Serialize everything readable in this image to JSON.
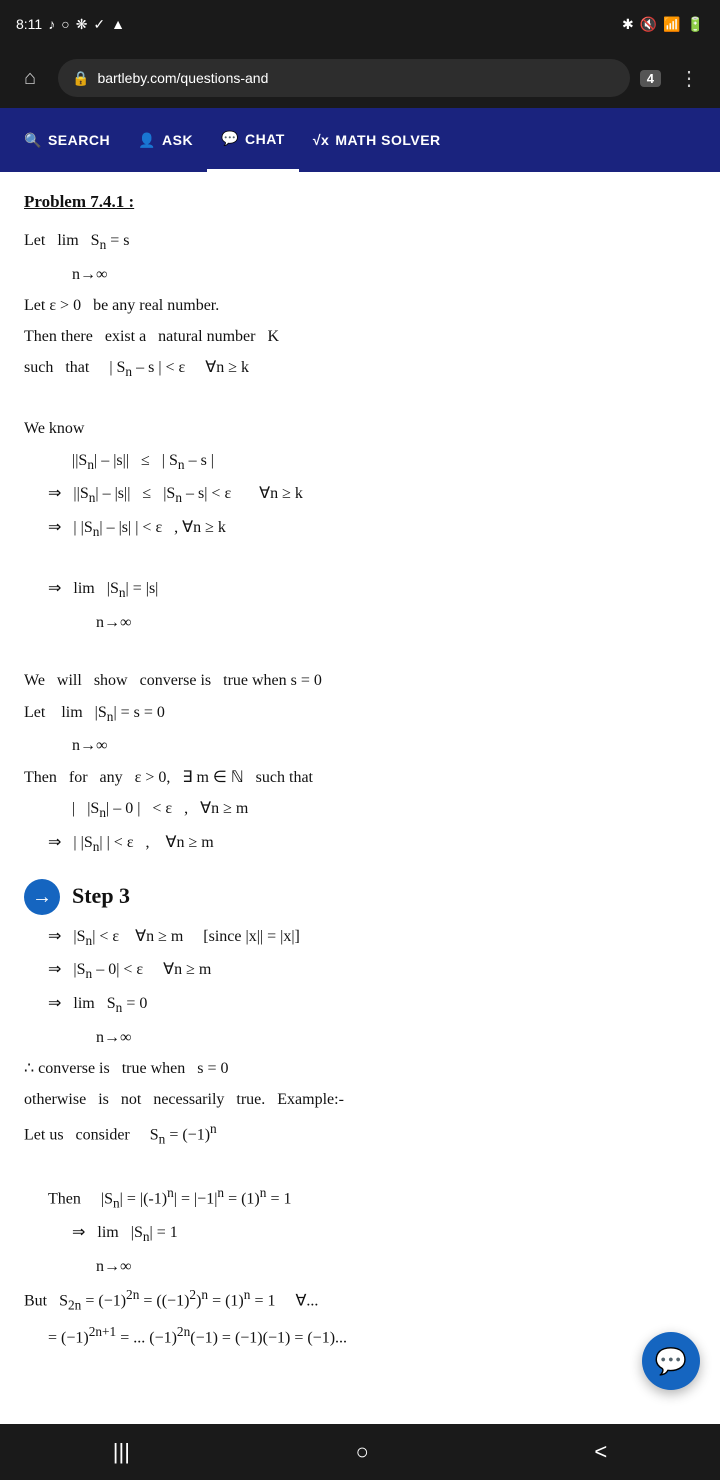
{
  "statusBar": {
    "time": "8:11",
    "icons_left": [
      "music-note",
      "circle-o",
      "settings-icon",
      "check-icon",
      "cloud-icon"
    ],
    "icons_right": [
      "bluetooth-icon",
      "mute-icon",
      "signal-icon",
      "battery-icon"
    ]
  },
  "browserBar": {
    "url": "bartleby.com/questions-and",
    "tabCount": "4",
    "homeIcon": "⌂",
    "menuIcon": "⋮"
  },
  "navBar": {
    "items": [
      {
        "id": "search",
        "label": "SEARCH",
        "icon": "🔍"
      },
      {
        "id": "ask",
        "label": "ASK",
        "icon": "👤"
      },
      {
        "id": "chat",
        "label": "CHAT",
        "icon": "💬"
      },
      {
        "id": "math",
        "label": "MATH SOLVER",
        "icon": "√x"
      }
    ],
    "activeItem": "chat"
  },
  "content": {
    "problemTitle": "Problem 7.4.1 :",
    "lines": [
      "Let  lim  Sₙ = s",
      "       n→∞",
      "Let ε > 0  be any real number.",
      "Then there  exist a  natural number  K",
      "such  that    | Sₙ – s | < ε    ∀n ≥ k",
      "",
      "We know",
      "    ||Sₙ| – |s||  ≤  | Sₙ – s |",
      "    ⇒  ||Sₙ| – |s||  ≤  |Sₙ – s| < ε      ∀n ≥ k",
      "    ⇒  | |Sₙ| – |s| | < ε  , ∀n ≥ k",
      "",
      "    ⇒  lim  |Sₙ| = |s|",
      "         n→∞",
      "",
      "We  will  show  converse is  true when s = 0",
      "Let   lim  |Sₙ| = s = 0",
      "        n→∞",
      "Then  for  any  ε > 0,  ∃ m ∈ ℕ  such that",
      "    |  |Sₙ| – 0 |  < ε  ,  ∀n ≥ m",
      "    ⇒  | |Sₙ| | < ε  ,   ∀n ≥ m"
    ],
    "step3": {
      "label": "Step 3",
      "lines": [
        "    ⇒  |Sₙ| < ε    ∀n ≥ m    [since |x|| = |x|]",
        "    ⇒  |Sₙ – 0| < ε    ∀n ≥ m",
        "    ⇒  lim  Sₙ = 0",
        "         n→∞",
        "∴ converse is  true when  s = 0",
        "otherwise  is  not  necessarily  true.  Example:-",
        "Let us  consider    Sₙ = (-1)ⁿ",
        "",
        "Then    |Sₙ| = |(-1)ⁿ| = |-1|ⁿ = (1)ⁿ = 1",
        "    ⇒  lim  |Sₙ| = 1",
        "         n→∞",
        "But   S₂ₙ = (-1)²ⁿ = ((-1)²)ⁿ = (1)ⁿ = 1    ∀...",
        "        = (-1)²ⁿ⁺¹ = ... (−1)²ⁿ(−1) = (−1)(−1) = (−1)..."
      ]
    }
  },
  "chatFab": {
    "icon": "💬",
    "label": "Chat"
  },
  "bottomNav": {
    "items": [
      {
        "id": "menu",
        "symbol": "|||"
      },
      {
        "id": "home",
        "symbol": "○"
      },
      {
        "id": "back",
        "symbol": "<"
      }
    ]
  }
}
